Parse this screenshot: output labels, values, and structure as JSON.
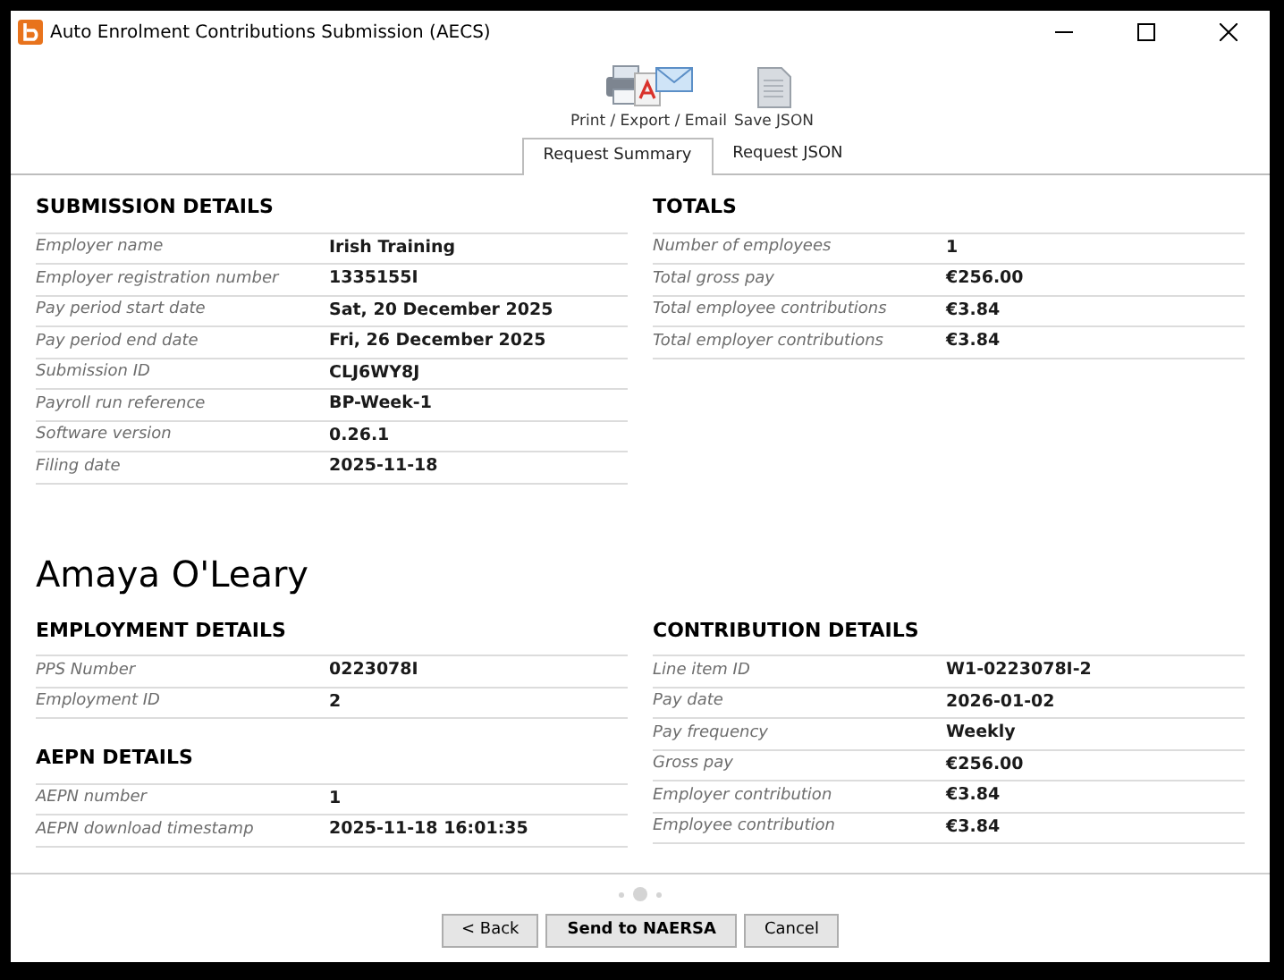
{
  "window": {
    "title": "Auto Enrolment Contributions Submission (AECS)"
  },
  "toolbar": [
    {
      "kind": "print",
      "label": "Print / Export / Email"
    },
    {
      "kind": "save",
      "label": "Save JSON"
    }
  ],
  "tabs": [
    {
      "label": "Request Summary",
      "selected": true
    },
    {
      "label": "Request JSON",
      "selected": false
    }
  ],
  "submission_details": {
    "heading": "SUBMISSION DETAILS",
    "rows": [
      {
        "label": "Employer name",
        "value": "Irish Training"
      },
      {
        "label": "Employer registration number",
        "value": "1335155I"
      },
      {
        "label": "Pay period start date",
        "value": "Sat, 20 December 2025"
      },
      {
        "label": "Pay period end date",
        "value": "Fri, 26 December 2025"
      },
      {
        "label": "Submission ID",
        "value": "CLJ6WY8J"
      },
      {
        "label": "Payroll run reference",
        "value": "BP-Week-1"
      },
      {
        "label": "Software version",
        "value": "0.26.1"
      },
      {
        "label": "Filing date",
        "value": "2025-11-18"
      }
    ]
  },
  "totals": {
    "heading": "TOTALS",
    "rows": [
      {
        "label": "Number of employees",
        "value": "1"
      },
      {
        "label": "Total gross pay",
        "value": "€256.00"
      },
      {
        "label": "Total employee contributions",
        "value": "€3.84"
      },
      {
        "label": "Total employer contributions",
        "value": "€3.84"
      }
    ]
  },
  "employee_name": "Amaya O'Leary",
  "employment_details": {
    "heading": "EMPLOYMENT DETAILS",
    "rows": [
      {
        "label": "PPS Number",
        "value": "0223078I"
      },
      {
        "label": "Employment ID",
        "value": "2"
      }
    ]
  },
  "aepn_details": {
    "heading": "AEPN DETAILS",
    "rows": [
      {
        "label": "AEPN number",
        "value": "1"
      },
      {
        "label": "AEPN download timestamp",
        "value": "2025-11-18 16:01:35"
      }
    ]
  },
  "contribution_details": {
    "heading": "CONTRIBUTION DETAILS",
    "rows": [
      {
        "label": "Line item ID",
        "value": "W1-0223078I-2"
      },
      {
        "label": "Pay date",
        "value": "2026-01-02"
      },
      {
        "label": "Pay frequency",
        "value": "Weekly"
      },
      {
        "label": "Gross pay",
        "value": "€256.00"
      },
      {
        "label": "Employer contribution",
        "value": "€3.84"
      },
      {
        "label": "Employee contribution",
        "value": "€3.84"
      }
    ]
  },
  "pager": [
    {
      "selected": false
    },
    {
      "selected": true
    },
    {
      "selected": false
    }
  ],
  "buttons": [
    {
      "label": "< Back",
      "primary": false
    },
    {
      "label": "Send to NAERSA",
      "primary": true
    },
    {
      "label": "Cancel",
      "primary": false
    }
  ]
}
